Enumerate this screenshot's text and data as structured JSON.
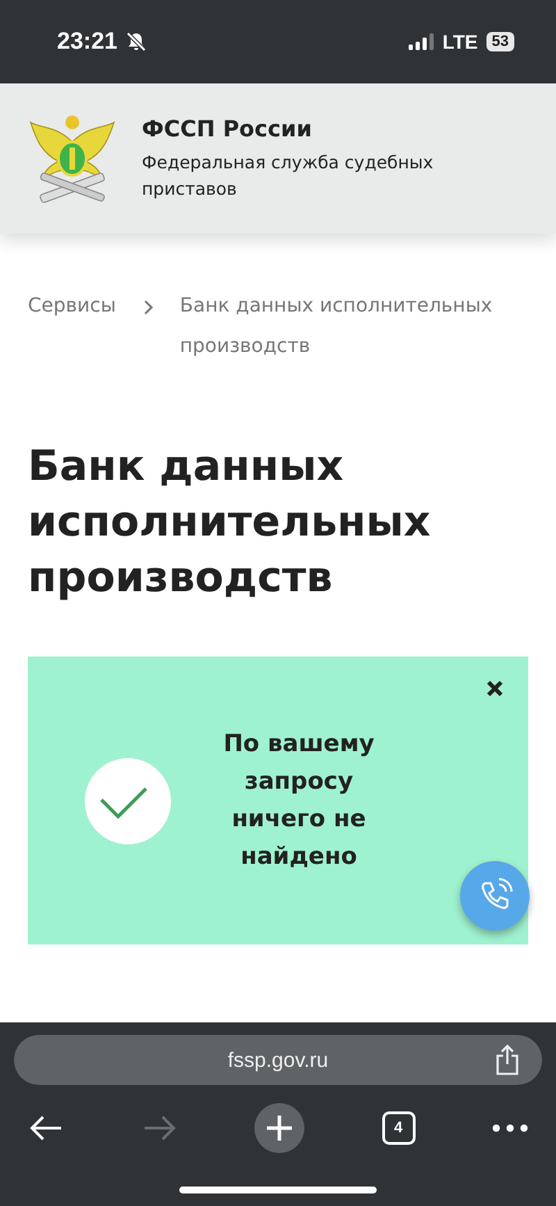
{
  "status_bar": {
    "time": "23:21",
    "network": "LTE",
    "battery": "53"
  },
  "header": {
    "title": "ФССП России",
    "subtitle": "Федеральная служба судебных приставов"
  },
  "breadcrumbs": [
    "Сервисы",
    "Банк данных исполнительных производств"
  ],
  "page_title": "Банк данных исполнительных производств",
  "result": {
    "message": "По вашему запросу ничего не найдено"
  },
  "browser": {
    "url": "fssp.gov.ru",
    "tab_count": "4",
    "forward_disabled": true
  }
}
